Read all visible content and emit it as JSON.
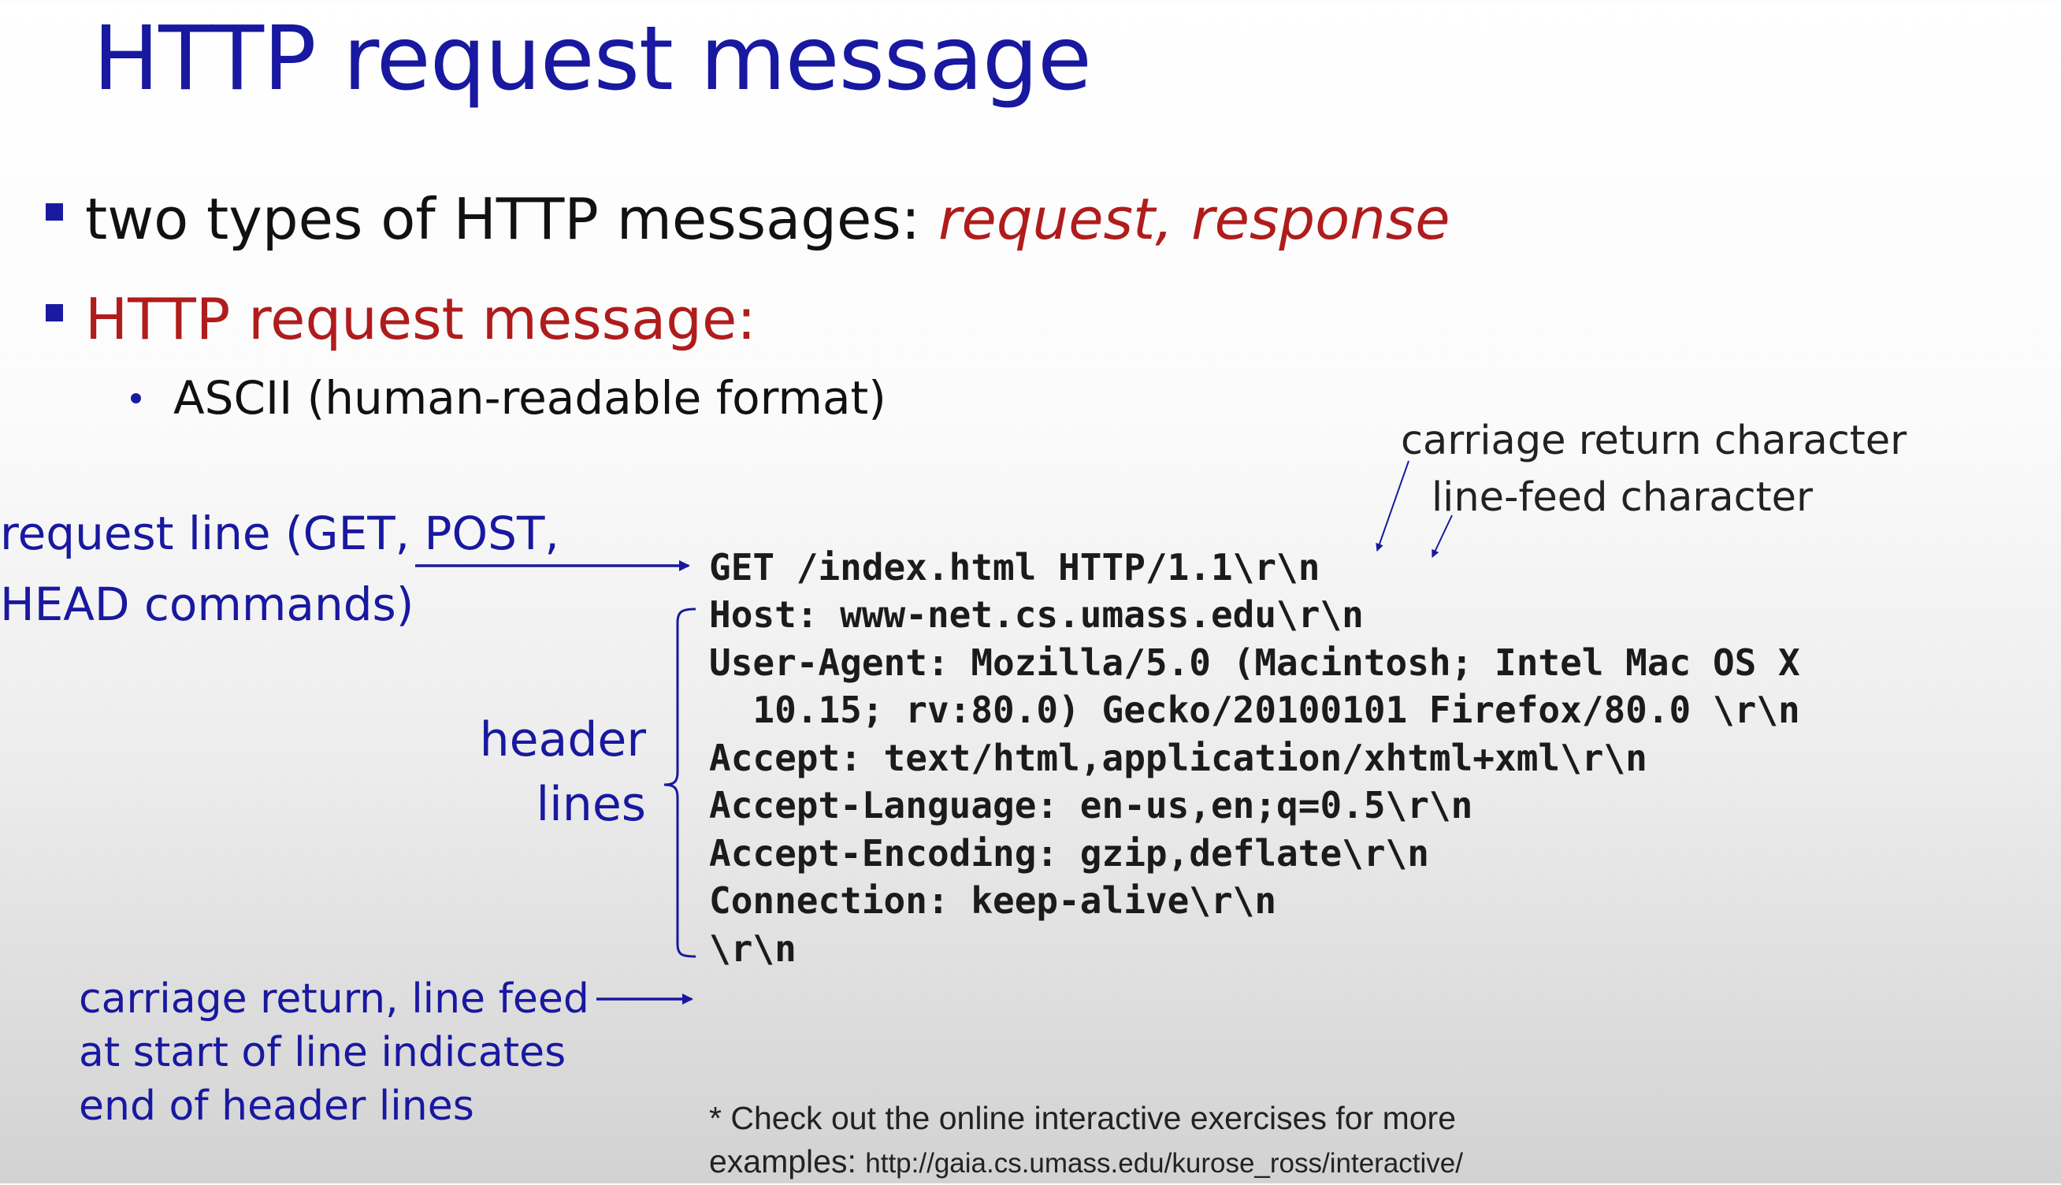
{
  "title": "HTTP request message",
  "bullets": {
    "b1_text": "two types of HTTP messages: ",
    "b1_emphasis": "request, response",
    "b2_text": "HTTP request message:",
    "b3_text": "ASCII (human-readable format)"
  },
  "annotations": {
    "request_line_1": "request line (GET, POST,",
    "request_line_2": "HEAD commands)",
    "header_1": "header",
    "header_2": "lines",
    "crlf_1": "carriage return, line feed",
    "crlf_2": "at start of line indicates",
    "crlf_3": "end of header lines",
    "carriage_return_char": "carriage return character",
    "line_feed_char": "line-feed character"
  },
  "code_lines": [
    "GET /index.html HTTP/1.1\\r\\n",
    "Host: www-net.cs.umass.edu\\r\\n",
    "User-Agent: Mozilla/5.0 (Macintosh; Intel Mac OS X",
    "  10.15; rv:80.0) Gecko/20100101 Firefox/80.0 \\r\\n",
    "Accept: text/html,application/xhtml+xml\\r\\n",
    "Accept-Language: en-us,en;q=0.5\\r\\n",
    "Accept-Encoding: gzip,deflate\\r\\n",
    "Connection: keep-alive\\r\\n",
    "\\r\\n"
  ],
  "footnote": {
    "line1": "* Check out the online interactive exercises for more",
    "line2_prefix": "examples: ",
    "url": "http://gaia.cs.umass.edu/kurose_ross/interactive/"
  },
  "colors": {
    "title_blue": "#1818a0",
    "accent_red": "#b01c1c",
    "code_text": "#1b1b1b"
  },
  "icons": [
    "square-bullet-icon",
    "round-bullet-icon",
    "arrow-icon",
    "brace-icon"
  ]
}
